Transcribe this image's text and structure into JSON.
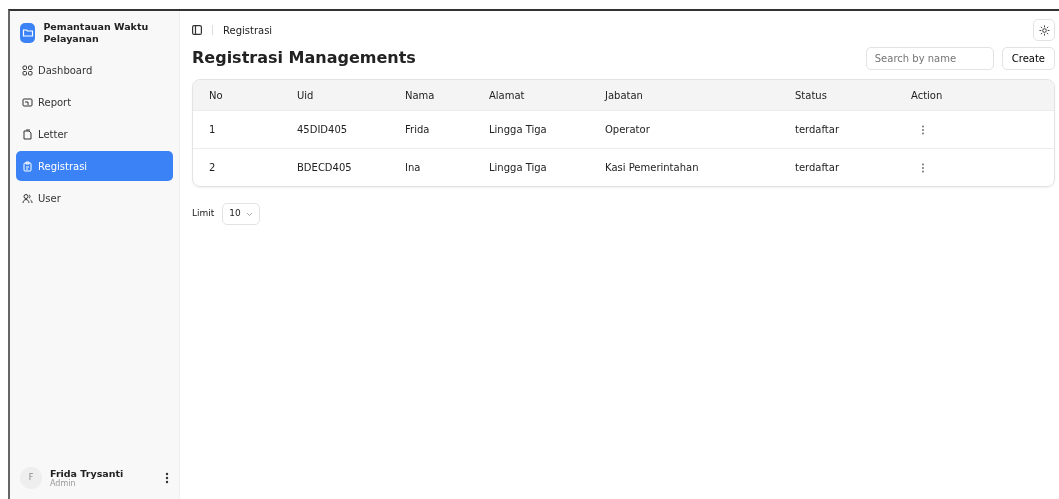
{
  "app": {
    "title": "Pemantauan Waktu Pelayanan"
  },
  "sidebar": {
    "items": [
      {
        "label": "Dashboard",
        "selected": false
      },
      {
        "label": "Report",
        "selected": false
      },
      {
        "label": "Letter",
        "selected": false
      },
      {
        "label": "Registrasi",
        "selected": true
      },
      {
        "label": "User",
        "selected": false
      }
    ]
  },
  "user": {
    "initial": "F",
    "name": "Frida Trysanti",
    "role": "Admin"
  },
  "breadcrumb": "Registrasi",
  "page_title": "Registrasi Managements",
  "search": {
    "placeholder": "Search by name"
  },
  "create_button": "Create",
  "table": {
    "columns": [
      "No",
      "Uid",
      "Nama",
      "Alamat",
      "Jabatan",
      "Status",
      "Action"
    ],
    "rows": [
      [
        "1",
        "45DID405",
        "Frida",
        "Lingga Tiga",
        "Operator",
        "terdaftar"
      ],
      [
        "2",
        "BDECD405",
        "Ina",
        "Lingga Tiga",
        "Kasi Pemerintahan",
        "terdaftar"
      ]
    ]
  },
  "limit": {
    "label": "Limit",
    "value": "10"
  }
}
